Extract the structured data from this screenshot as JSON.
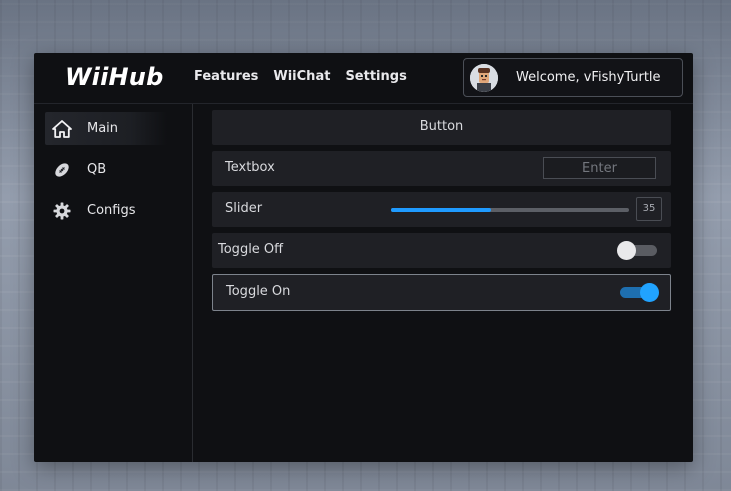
{
  "app": {
    "title": "WiiHub"
  },
  "nav": {
    "items": [
      {
        "label": "Features"
      },
      {
        "label": "WiiChat"
      },
      {
        "label": "Settings"
      }
    ]
  },
  "user": {
    "welcome_text": "Welcome, vFishyTurtle"
  },
  "sidebar": {
    "items": [
      {
        "label": "Main",
        "icon": "home-icon",
        "active": true
      },
      {
        "label": "QB",
        "icon": "football-icon",
        "active": false
      },
      {
        "label": "Configs",
        "icon": "gear-icon",
        "active": false
      }
    ]
  },
  "main": {
    "button": {
      "label": "Button"
    },
    "textbox": {
      "label": "Textbox",
      "placeholder": "Enter",
      "value": ""
    },
    "slider": {
      "label": "Slider",
      "value": "35",
      "fill_fraction": 0.42
    },
    "toggle_off": {
      "label": "Toggle Off",
      "state": false
    },
    "toggle_on": {
      "label": "Toggle On",
      "state": true
    }
  },
  "colors": {
    "accent": "#1f9bff",
    "panel": "#0f1013",
    "row": "#1f2025"
  }
}
